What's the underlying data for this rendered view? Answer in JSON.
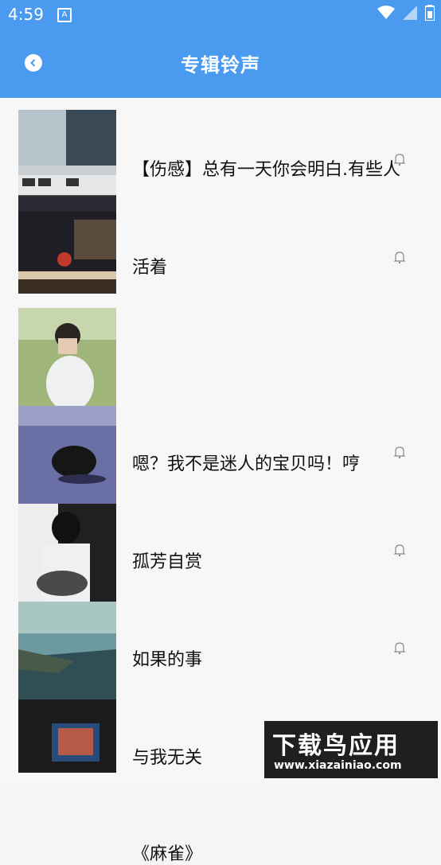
{
  "status": {
    "time": "4:59",
    "app_icon_letter": "A"
  },
  "appbar": {
    "title": "专辑铃声"
  },
  "icons": {
    "back": "back-chevron-icon",
    "bell": "bell-icon"
  },
  "list": [
    {
      "title": "【伤感】总有一天你会明白.有些人",
      "thumb": "train-station"
    },
    {
      "title": "活着",
      "thumb": "restaurant-interior"
    },
    {
      "title": "嗯？我不是迷人的宝贝吗！哼",
      "thumb": "girl-in-field"
    },
    {
      "title": "孤芳自赏",
      "thumb": "person-on-stairs"
    },
    {
      "title": "如果的事",
      "thumb": "guitar-player"
    },
    {
      "title": "与我无关",
      "thumb": "cliff-lake"
    },
    {
      "title": "《麻雀》",
      "thumb": "photo-frame"
    }
  ],
  "watermark": {
    "title": "下载鸟应用",
    "url": "www.xiazainiao.com"
  }
}
